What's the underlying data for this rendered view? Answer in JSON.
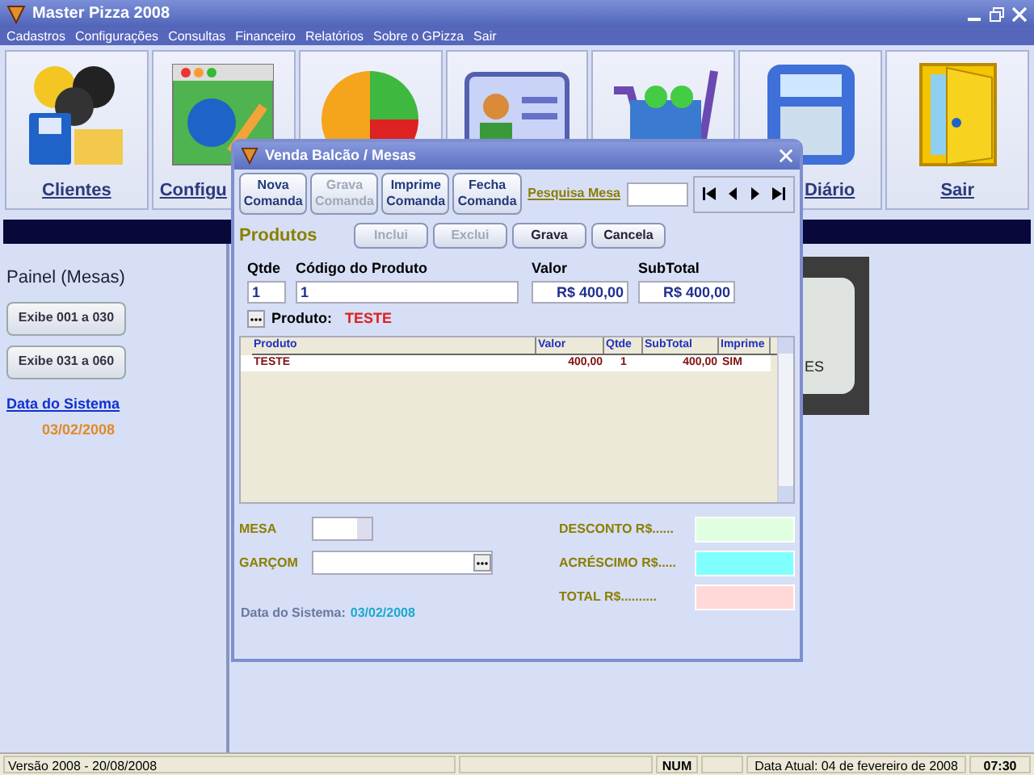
{
  "window": {
    "title": "Master Pizza 2008"
  },
  "menu": [
    "Cadastros",
    "Configurações",
    "Consultas",
    "Financeiro",
    "Relatórios",
    "Sobre o GPizza",
    "Sair"
  ],
  "toolbar": [
    {
      "kind": "people",
      "label": "Clientes"
    },
    {
      "kind": "globe",
      "label": "Configu"
    },
    {
      "kind": "pie"
    },
    {
      "kind": "card"
    },
    {
      "kind": "cart"
    },
    {
      "kind": "calculator",
      "label": "Diário"
    },
    {
      "kind": "door",
      "label": "Sair"
    }
  ],
  "panel": {
    "title": "Painel (Mesas)",
    "buttons": [
      "Exibe 001 a 030",
      "Exibe 031 a 060"
    ],
    "date_link": "Data do Sistema",
    "date": "03/02/2008",
    "background_text": "ES"
  },
  "dialog": {
    "title": "Venda Balcão / Mesas",
    "commands": [
      {
        "label": "Nova Comanda",
        "disabled": false
      },
      {
        "label": "Grava Comanda",
        "disabled": true
      },
      {
        "label": "Imprime Comanda",
        "disabled": false
      },
      {
        "label": "Fecha Comanda",
        "disabled": false
      }
    ],
    "search_label": "Pesquisa Mesa",
    "products_label": "Produtos",
    "product_buttons": [
      {
        "label": "Inclui",
        "disabled": true
      },
      {
        "label": "Exclui",
        "disabled": true
      },
      {
        "label": "Grava",
        "disabled": false
      },
      {
        "label": "Cancela",
        "disabled": false
      }
    ],
    "qtde": {
      "label": "Qtde",
      "value": "1"
    },
    "codigo": {
      "label": "Código do Produto",
      "value": "1"
    },
    "valor": {
      "label": "Valor",
      "value": "R$ 400,00"
    },
    "subtotal": {
      "label": "SubTotal",
      "value": "R$ 400,00"
    },
    "produto": {
      "label": "Produto:",
      "value": "TESTE"
    },
    "grid": {
      "columns": [
        "Produto",
        "Valor",
        "Qtde",
        "SubTotal",
        "Imprime"
      ],
      "rows": [
        {
          "cells": [
            "TESTE",
            "400,00",
            "1",
            "400,00",
            "SIM"
          ],
          "selected": true
        }
      ]
    },
    "mesa_label": "MESA",
    "garcom_label": "GARÇOM",
    "totals": [
      {
        "label": "DESCONTO R$......",
        "color": "#e0ffe0"
      },
      {
        "label": "ACRÉSCIMO R$.....",
        "color": "#80ffff"
      },
      {
        "label": "TOTAL R$..........",
        "color": "#ffd8d8"
      }
    ],
    "system_date_label": "Data do Sistema:",
    "system_date": "03/02/2008"
  },
  "status_bar": [
    {
      "kind": "text",
      "text": "Versão 2008 - 20/08/2008"
    },
    {
      "kind": "blank"
    },
    {
      "kind": "bold",
      "text": "NUM"
    },
    {
      "kind": "blank"
    },
    {
      "kind": "text",
      "text": "Data Atual: 04 de fevereiro de 2008"
    },
    {
      "kind": "bold",
      "text": "07:30"
    }
  ]
}
